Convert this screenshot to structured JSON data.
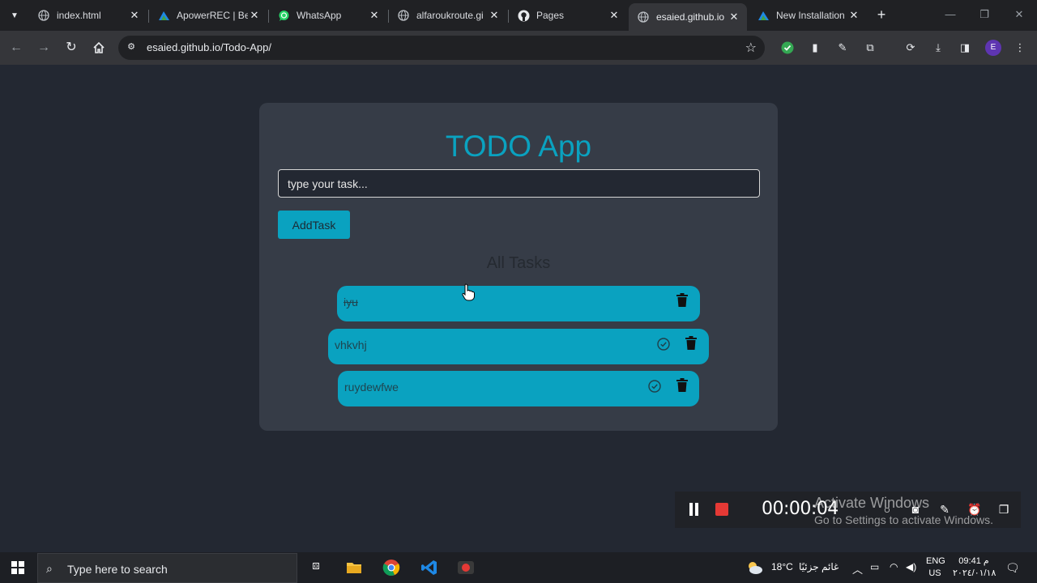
{
  "browser": {
    "tabs": [
      {
        "title": "index.html",
        "icon": "globe-icon",
        "active": false
      },
      {
        "title": "ApowerREC | Be",
        "icon": "apowerrec-icon",
        "active": false
      },
      {
        "title": "WhatsApp",
        "icon": "whatsapp-icon",
        "active": false
      },
      {
        "title": "alfaroukroute.gi",
        "icon": "globe-icon",
        "active": false
      },
      {
        "title": "Pages",
        "icon": "github-icon",
        "active": false
      },
      {
        "title": "esaied.github.io",
        "icon": "globe-icon",
        "active": true
      },
      {
        "title": "New Installation",
        "icon": "apowerrec-icon",
        "active": false
      }
    ],
    "url": "esaied.github.io/Todo-App/",
    "profile_initial": "E"
  },
  "app": {
    "title": "TODO App",
    "input_placeholder": "type your task...",
    "add_button": "AddTask",
    "list_heading": "All Tasks",
    "tasks": [
      {
        "text": "iyu",
        "completed": true
      },
      {
        "text": "vhkvhj",
        "completed": false
      },
      {
        "text": "ruydewfwe",
        "completed": false
      }
    ],
    "accent_color": "#0aa2c0"
  },
  "recorder": {
    "time": "00:00:04"
  },
  "watermark": {
    "line1": "Activate Windows",
    "line2": "Go to Settings to activate Windows."
  },
  "taskbar": {
    "search_placeholder": "Type here to search",
    "temperature": "18°C",
    "weather_text": "غائم جزئيًا",
    "language": "ENG",
    "region": "US",
    "time": "09:41 م",
    "date": "٢٠٢٤/٠١/١٨"
  }
}
